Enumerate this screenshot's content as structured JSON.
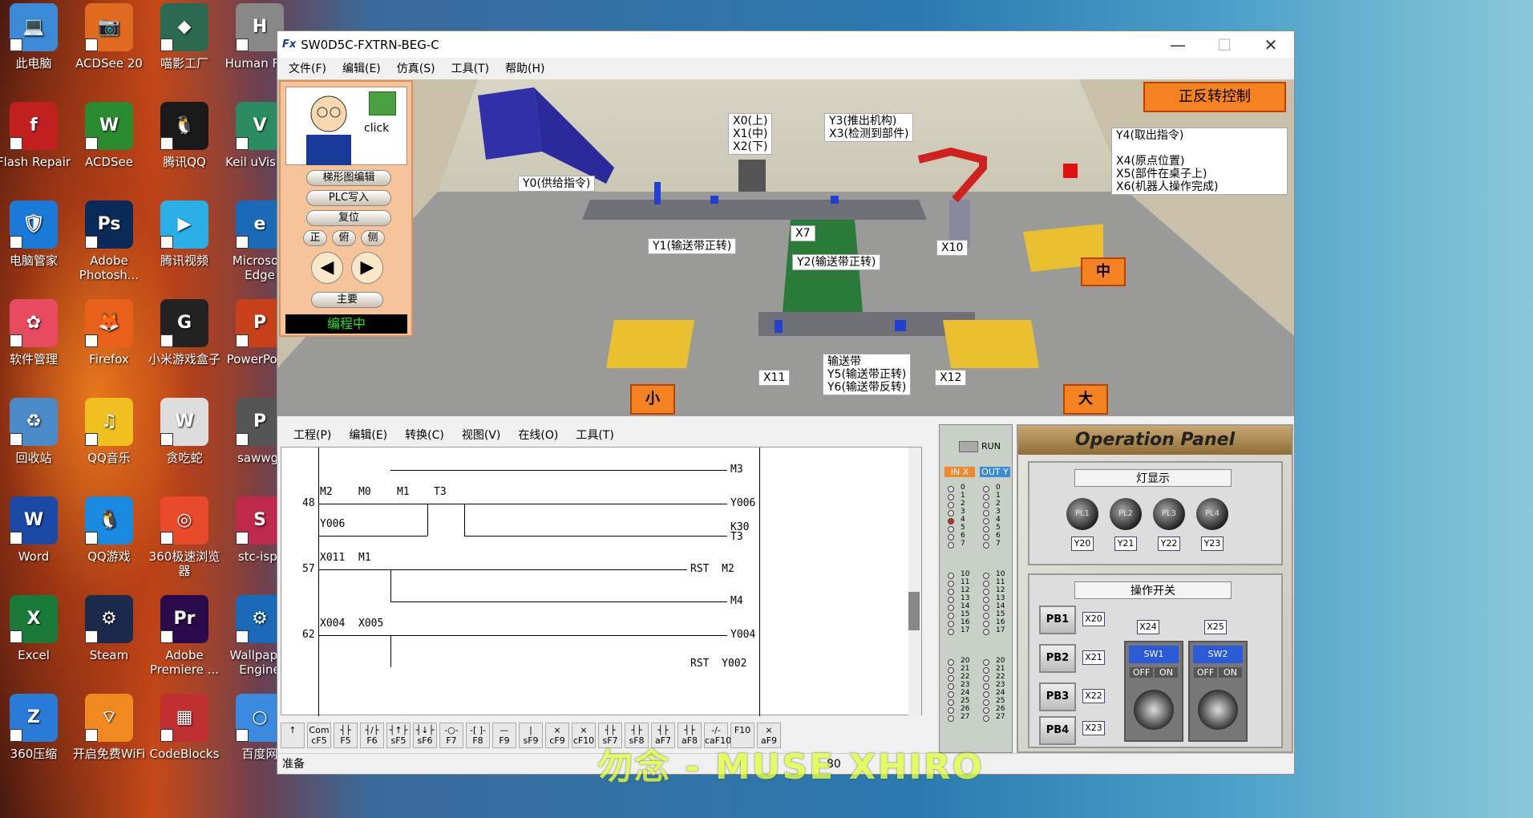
{
  "desktop": {
    "icons": [
      {
        "label": "此电脑",
        "col": "#3a8ad8",
        "glyph": "💻"
      },
      {
        "label": "ACDSee 20",
        "col": "#e06a20",
        "glyph": "📷"
      },
      {
        "label": "喵影工厂",
        "col": "#2a6a50",
        "glyph": "◆"
      },
      {
        "label": "Human Flat",
        "col": "#888",
        "glyph": "H"
      },
      {
        "label": "Flash Repair",
        "col": "#c02020",
        "glyph": "f"
      },
      {
        "label": "ACDSee",
        "col": "#2a8a30",
        "glyph": "W"
      },
      {
        "label": "腾讯QQ",
        "col": "#1a1a1a",
        "glyph": "🐧"
      },
      {
        "label": "Keil uVision",
        "col": "#2a8a60",
        "glyph": "V"
      },
      {
        "label": "电脑管家",
        "col": "#1a7ad8",
        "glyph": "🛡"
      },
      {
        "label": "Adobe Photosh...",
        "col": "#0a2a5a",
        "glyph": "Ps"
      },
      {
        "label": "腾讯视频",
        "col": "#2ab0e8",
        "glyph": "▶"
      },
      {
        "label": "Microsoft Edge",
        "col": "#1a6ab8",
        "glyph": "e"
      },
      {
        "label": "软件管理",
        "col": "#e84a60",
        "glyph": "✿"
      },
      {
        "label": "Firefox",
        "col": "#e8601a",
        "glyph": "🦊"
      },
      {
        "label": "小米游戏盒子",
        "col": "#222",
        "glyph": "G"
      },
      {
        "label": "PowerPoint",
        "col": "#c8401a",
        "glyph": "P"
      },
      {
        "label": "回收站",
        "col": "#4a8ac8",
        "glyph": "♻"
      },
      {
        "label": "QQ音乐",
        "col": "#f0c020",
        "glyph": "♫"
      },
      {
        "label": "贪吃蛇",
        "col": "#ddd",
        "glyph": "W"
      },
      {
        "label": "sawwg.",
        "col": "#555",
        "glyph": "P"
      },
      {
        "label": "Word",
        "col": "#1a4aa8",
        "glyph": "W"
      },
      {
        "label": "QQ游戏",
        "col": "#1a8ae0",
        "glyph": "🐧"
      },
      {
        "label": "360极速浏览器",
        "col": "#e84a2a",
        "glyph": "◎"
      },
      {
        "label": "stc-isp-",
        "col": "#c02a4a",
        "glyph": "S"
      },
      {
        "label": "Excel",
        "col": "#1a7a3a",
        "glyph": "X"
      },
      {
        "label": "Steam",
        "col": "#1a2a4a",
        "glyph": "⚙"
      },
      {
        "label": "Adobe Premiere ...",
        "col": "#2a0a4a",
        "glyph": "Pr"
      },
      {
        "label": "Wallpaper Engine",
        "col": "#1a6ab8",
        "glyph": "⚙"
      },
      {
        "label": "360压缩",
        "col": "#2a7ad8",
        "glyph": "Z"
      },
      {
        "label": "开启免费WiFi",
        "col": "#f08a20",
        "glyph": "⌔"
      },
      {
        "label": "CodeBlocks",
        "col": "#c03030",
        "glyph": "▦"
      },
      {
        "label": "百度网",
        "col": "#3a8ae0",
        "glyph": "○"
      }
    ]
  },
  "window": {
    "title": "SW0D5C-FXTRN-BEG-C",
    "logo": "Fx",
    "controls": {
      "min": "—",
      "max": "☐",
      "close": "✕"
    },
    "menu": [
      "文件(F)",
      "编辑(E)",
      "仿真(S)",
      "工具(T)",
      "帮助(H)"
    ]
  },
  "scene": {
    "title": "正反转控制",
    "labels": {
      "x012": "X0(上)\nX1(中)\nX2(下)",
      "y3x3": "Y3(推出机构)\nX3(检测到部件)",
      "y4": "Y4(取出指令)\n\nX4(原点位置)\nX5(部件在桌子上)\nX6(机器人操作完成)",
      "y0": "Y0(供给指令)",
      "y1": "Y1(输送带正转)",
      "x7": "X7",
      "y2": "Y2(输送带正转)",
      "x10": "X10",
      "x11": "X11",
      "belt": "输送带\nY5(输送带正转)\nY6(输送带反转)",
      "x12": "X12"
    },
    "bins": {
      "mid": "中",
      "small": "小",
      "big": "大"
    }
  },
  "side": {
    "click": "click",
    "buttons": [
      "梯形图编辑",
      "PLC写入",
      "复位"
    ],
    "views": [
      "正",
      "俯",
      "侧"
    ],
    "main": "主要",
    "status": "编程中"
  },
  "editor": {
    "menu": [
      "工程(P)",
      "编辑(E)",
      "转换(C)",
      "视图(V)",
      "在线(O)",
      "工具(T)"
    ],
    "rungs": {
      "m3": "M3",
      "r48": "48",
      "m2": "M2",
      "m0": "M0",
      "m1": "M1",
      "t3": "T3",
      "y006": "Y006",
      "y006b": "Y006",
      "k30": "K30",
      "t3c": "T3",
      "r57": "57",
      "x011": "X011",
      "m1b": "M1",
      "rst": "RST  M2",
      "m4": "M4",
      "r62": "62",
      "x004": "X004",
      "x005": "X005",
      "y004": "Y004",
      "rst2": "RST  Y002"
    },
    "toolbar": [
      "↑",
      "Com\ncF5",
      "┤├\nF5",
      "┤/├\nF6",
      "┤↑├\nsF5",
      "┤↓├\nsF6",
      "-○-\nF7",
      "-[ ]-\nF8",
      "—\nF9",
      "|\nsF9",
      "⨯\ncF9",
      "⨯\ncF10",
      "┤├\nsF7",
      "┤├\nsF8",
      "┤├\naF7",
      "┤├\naF8",
      "-/-\ncaF10",
      "F10",
      "⨯\naF9"
    ]
  },
  "io": {
    "run": "RUN",
    "inx": "IN X",
    "outy": "OUT Y",
    "nums": [
      "0",
      "1",
      "2",
      "3",
      "4",
      "5",
      "6",
      "7",
      "10",
      "11",
      "12",
      "13",
      "14",
      "15",
      "16",
      "17",
      "20",
      "21",
      "22",
      "23",
      "24",
      "25",
      "26",
      "27"
    ],
    "active_in": "4"
  },
  "op": {
    "title": "Operation Panel",
    "lights_title": "灯显示",
    "lamps": [
      "PL1",
      "PL2",
      "PL3",
      "PL4"
    ],
    "lamp_y": [
      "Y20",
      "Y21",
      "Y22",
      "Y23"
    ],
    "switch_title": "操作开关",
    "pbs": [
      "PB1",
      "PB2",
      "PB3",
      "PB4"
    ],
    "pb_x": [
      "X20",
      "X21",
      "X22",
      "X23"
    ],
    "sws": [
      "SW1",
      "SW2"
    ],
    "sw_x": [
      "X24",
      "X25"
    ],
    "off": "OFF",
    "on": "ON"
  },
  "status": {
    "text": "准备",
    "zoom": "80"
  },
  "watermark": "勿念 - MUSE XHIRO"
}
